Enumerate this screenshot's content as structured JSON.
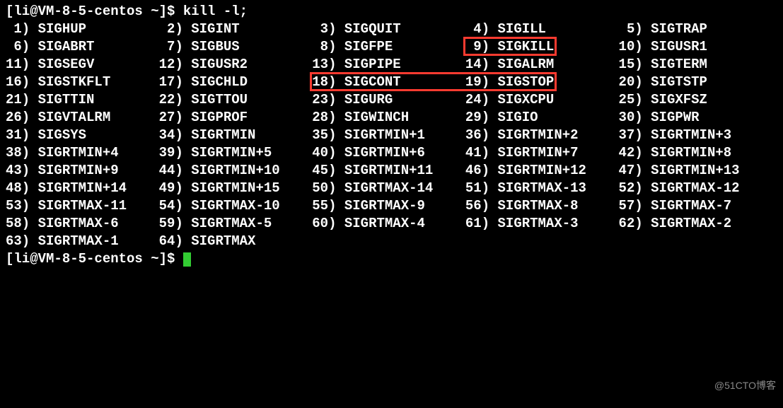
{
  "prompt1": "[li@VM-8-5-centos ~]$ kill -l;",
  "prompt2": "[li@VM-8-5-centos ~]$ ",
  "watermark": "@51CTO博客",
  "signals": [
    {
      "n": 1,
      "s": "SIGHUP"
    },
    {
      "n": 2,
      "s": "SIGINT"
    },
    {
      "n": 3,
      "s": "SIGQUIT"
    },
    {
      "n": 4,
      "s": "SIGILL"
    },
    {
      "n": 5,
      "s": "SIGTRAP"
    },
    {
      "n": 6,
      "s": "SIGABRT"
    },
    {
      "n": 7,
      "s": "SIGBUS"
    },
    {
      "n": 8,
      "s": "SIGFPE"
    },
    {
      "n": 9,
      "s": "SIGKILL"
    },
    {
      "n": 10,
      "s": "SIGUSR1"
    },
    {
      "n": 11,
      "s": "SIGSEGV"
    },
    {
      "n": 12,
      "s": "SIGUSR2"
    },
    {
      "n": 13,
      "s": "SIGPIPE"
    },
    {
      "n": 14,
      "s": "SIGALRM"
    },
    {
      "n": 15,
      "s": "SIGTERM"
    },
    {
      "n": 16,
      "s": "SIGSTKFLT"
    },
    {
      "n": 17,
      "s": "SIGCHLD"
    },
    {
      "n": 18,
      "s": "SIGCONT"
    },
    {
      "n": 19,
      "s": "SIGSTOP"
    },
    {
      "n": 20,
      "s": "SIGTSTP"
    },
    {
      "n": 21,
      "s": "SIGTTIN"
    },
    {
      "n": 22,
      "s": "SIGTTOU"
    },
    {
      "n": 23,
      "s": "SIGURG"
    },
    {
      "n": 24,
      "s": "SIGXCPU"
    },
    {
      "n": 25,
      "s": "SIGXFSZ"
    },
    {
      "n": 26,
      "s": "SIGVTALRM"
    },
    {
      "n": 27,
      "s": "SIGPROF"
    },
    {
      "n": 28,
      "s": "SIGWINCH"
    },
    {
      "n": 29,
      "s": "SIGIO"
    },
    {
      "n": 30,
      "s": "SIGPWR"
    },
    {
      "n": 31,
      "s": "SIGSYS"
    },
    {
      "n": 34,
      "s": "SIGRTMIN"
    },
    {
      "n": 35,
      "s": "SIGRTMIN+1"
    },
    {
      "n": 36,
      "s": "SIGRTMIN+2"
    },
    {
      "n": 37,
      "s": "SIGRTMIN+3"
    },
    {
      "n": 38,
      "s": "SIGRTMIN+4"
    },
    {
      "n": 39,
      "s": "SIGRTMIN+5"
    },
    {
      "n": 40,
      "s": "SIGRTMIN+6"
    },
    {
      "n": 41,
      "s": "SIGRTMIN+7"
    },
    {
      "n": 42,
      "s": "SIGRTMIN+8"
    },
    {
      "n": 43,
      "s": "SIGRTMIN+9"
    },
    {
      "n": 44,
      "s": "SIGRTMIN+10"
    },
    {
      "n": 45,
      "s": "SIGRTMIN+11"
    },
    {
      "n": 46,
      "s": "SIGRTMIN+12"
    },
    {
      "n": 47,
      "s": "SIGRTMIN+13"
    },
    {
      "n": 48,
      "s": "SIGRTMIN+14"
    },
    {
      "n": 49,
      "s": "SIGRTMIN+15"
    },
    {
      "n": 50,
      "s": "SIGRTMAX-14"
    },
    {
      "n": 51,
      "s": "SIGRTMAX-13"
    },
    {
      "n": 52,
      "s": "SIGRTMAX-12"
    },
    {
      "n": 53,
      "s": "SIGRTMAX-11"
    },
    {
      "n": 54,
      "s": "SIGRTMAX-10"
    },
    {
      "n": 55,
      "s": "SIGRTMAX-9"
    },
    {
      "n": 56,
      "s": "SIGRTMAX-8"
    },
    {
      "n": 57,
      "s": "SIGRTMAX-7"
    },
    {
      "n": 58,
      "s": "SIGRTMAX-6"
    },
    {
      "n": 59,
      "s": "SIGRTMAX-5"
    },
    {
      "n": 60,
      "s": "SIGRTMAX-4"
    },
    {
      "n": 61,
      "s": "SIGRTMAX-3"
    },
    {
      "n": 62,
      "s": "SIGRTMAX-2"
    },
    {
      "n": 63,
      "s": "SIGRTMAX-1"
    },
    {
      "n": 64,
      "s": "SIGRTMAX"
    }
  ],
  "highlight_signals": [
    9,
    18,
    19
  ]
}
